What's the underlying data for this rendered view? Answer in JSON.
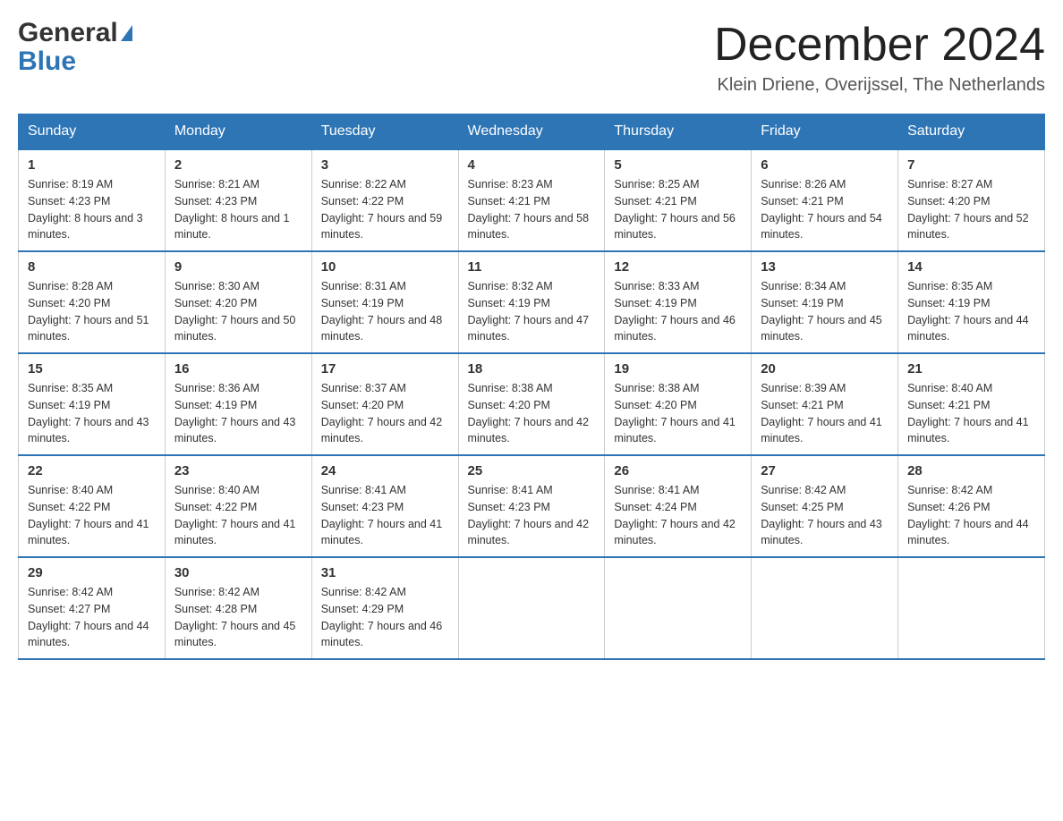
{
  "header": {
    "month_title": "December 2024",
    "location": "Klein Driene, Overijssel, The Netherlands",
    "logo_general": "General",
    "logo_blue": "Blue"
  },
  "weekdays": [
    "Sunday",
    "Monday",
    "Tuesday",
    "Wednesday",
    "Thursday",
    "Friday",
    "Saturday"
  ],
  "weeks": [
    [
      {
        "day": "1",
        "sunrise": "8:19 AM",
        "sunset": "4:23 PM",
        "daylight": "8 hours and 3 minutes."
      },
      {
        "day": "2",
        "sunrise": "8:21 AM",
        "sunset": "4:23 PM",
        "daylight": "8 hours and 1 minute."
      },
      {
        "day": "3",
        "sunrise": "8:22 AM",
        "sunset": "4:22 PM",
        "daylight": "7 hours and 59 minutes."
      },
      {
        "day": "4",
        "sunrise": "8:23 AM",
        "sunset": "4:21 PM",
        "daylight": "7 hours and 58 minutes."
      },
      {
        "day": "5",
        "sunrise": "8:25 AM",
        "sunset": "4:21 PM",
        "daylight": "7 hours and 56 minutes."
      },
      {
        "day": "6",
        "sunrise": "8:26 AM",
        "sunset": "4:21 PM",
        "daylight": "7 hours and 54 minutes."
      },
      {
        "day": "7",
        "sunrise": "8:27 AM",
        "sunset": "4:20 PM",
        "daylight": "7 hours and 52 minutes."
      }
    ],
    [
      {
        "day": "8",
        "sunrise": "8:28 AM",
        "sunset": "4:20 PM",
        "daylight": "7 hours and 51 minutes."
      },
      {
        "day": "9",
        "sunrise": "8:30 AM",
        "sunset": "4:20 PM",
        "daylight": "7 hours and 50 minutes."
      },
      {
        "day": "10",
        "sunrise": "8:31 AM",
        "sunset": "4:19 PM",
        "daylight": "7 hours and 48 minutes."
      },
      {
        "day": "11",
        "sunrise": "8:32 AM",
        "sunset": "4:19 PM",
        "daylight": "7 hours and 47 minutes."
      },
      {
        "day": "12",
        "sunrise": "8:33 AM",
        "sunset": "4:19 PM",
        "daylight": "7 hours and 46 minutes."
      },
      {
        "day": "13",
        "sunrise": "8:34 AM",
        "sunset": "4:19 PM",
        "daylight": "7 hours and 45 minutes."
      },
      {
        "day": "14",
        "sunrise": "8:35 AM",
        "sunset": "4:19 PM",
        "daylight": "7 hours and 44 minutes."
      }
    ],
    [
      {
        "day": "15",
        "sunrise": "8:35 AM",
        "sunset": "4:19 PM",
        "daylight": "7 hours and 43 minutes."
      },
      {
        "day": "16",
        "sunrise": "8:36 AM",
        "sunset": "4:19 PM",
        "daylight": "7 hours and 43 minutes."
      },
      {
        "day": "17",
        "sunrise": "8:37 AM",
        "sunset": "4:20 PM",
        "daylight": "7 hours and 42 minutes."
      },
      {
        "day": "18",
        "sunrise": "8:38 AM",
        "sunset": "4:20 PM",
        "daylight": "7 hours and 42 minutes."
      },
      {
        "day": "19",
        "sunrise": "8:38 AM",
        "sunset": "4:20 PM",
        "daylight": "7 hours and 41 minutes."
      },
      {
        "day": "20",
        "sunrise": "8:39 AM",
        "sunset": "4:21 PM",
        "daylight": "7 hours and 41 minutes."
      },
      {
        "day": "21",
        "sunrise": "8:40 AM",
        "sunset": "4:21 PM",
        "daylight": "7 hours and 41 minutes."
      }
    ],
    [
      {
        "day": "22",
        "sunrise": "8:40 AM",
        "sunset": "4:22 PM",
        "daylight": "7 hours and 41 minutes."
      },
      {
        "day": "23",
        "sunrise": "8:40 AM",
        "sunset": "4:22 PM",
        "daylight": "7 hours and 41 minutes."
      },
      {
        "day": "24",
        "sunrise": "8:41 AM",
        "sunset": "4:23 PM",
        "daylight": "7 hours and 41 minutes."
      },
      {
        "day": "25",
        "sunrise": "8:41 AM",
        "sunset": "4:23 PM",
        "daylight": "7 hours and 42 minutes."
      },
      {
        "day": "26",
        "sunrise": "8:41 AM",
        "sunset": "4:24 PM",
        "daylight": "7 hours and 42 minutes."
      },
      {
        "day": "27",
        "sunrise": "8:42 AM",
        "sunset": "4:25 PM",
        "daylight": "7 hours and 43 minutes."
      },
      {
        "day": "28",
        "sunrise": "8:42 AM",
        "sunset": "4:26 PM",
        "daylight": "7 hours and 44 minutes."
      }
    ],
    [
      {
        "day": "29",
        "sunrise": "8:42 AM",
        "sunset": "4:27 PM",
        "daylight": "7 hours and 44 minutes."
      },
      {
        "day": "30",
        "sunrise": "8:42 AM",
        "sunset": "4:28 PM",
        "daylight": "7 hours and 45 minutes."
      },
      {
        "day": "31",
        "sunrise": "8:42 AM",
        "sunset": "4:29 PM",
        "daylight": "7 hours and 46 minutes."
      },
      null,
      null,
      null,
      null
    ]
  ]
}
